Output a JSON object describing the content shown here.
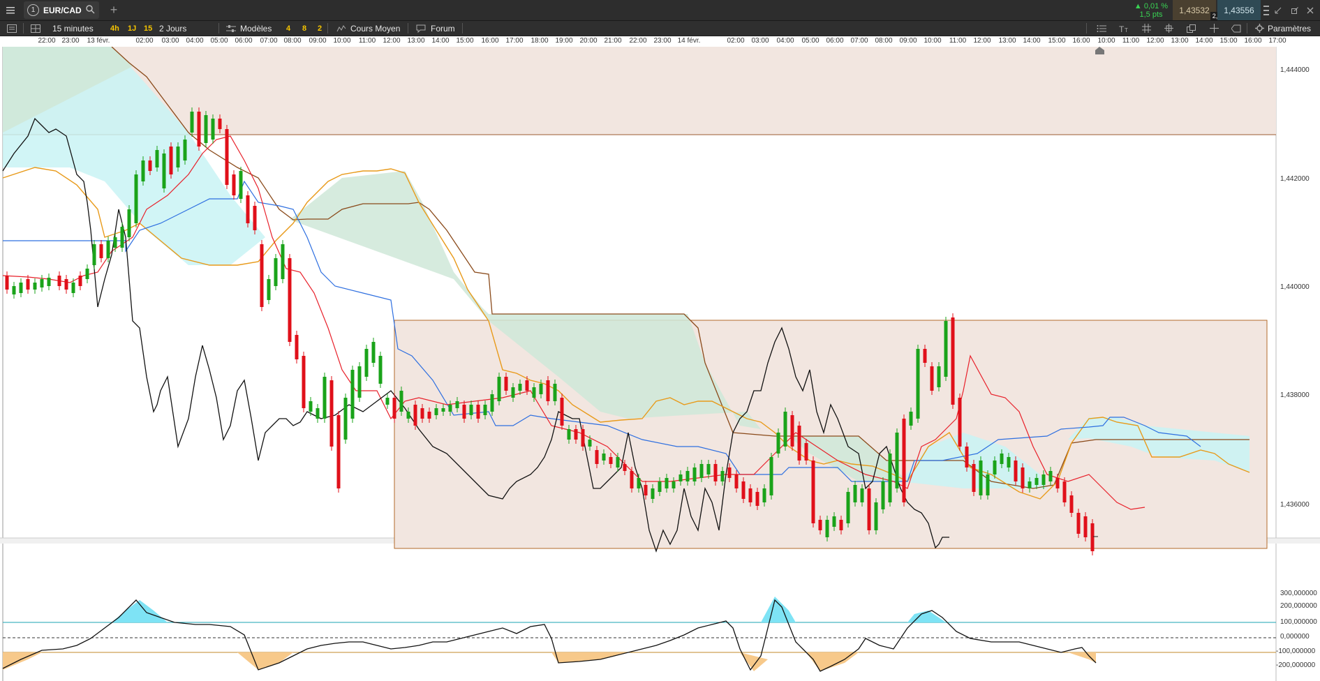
{
  "topbar": {
    "menu_icon": "hamburger-icon",
    "tab_number": "1",
    "symbol": "EUR/CAD",
    "add_tab": "+",
    "change_pct": "▲ 0,01 %",
    "change_pts": "1,5 pts",
    "bid": "1,43532",
    "spread": "2,4",
    "ask": "1,43556",
    "colors": {
      "up": "#39d353",
      "bid_bg": "#4a4030",
      "ask_bg": "#2f4a55"
    }
  },
  "toolbar": {
    "timeframe": "15 minutes",
    "quick_tf": [
      "4h",
      "1J",
      "15"
    ],
    "period": "2 Jours",
    "models": "Modèles",
    "counts": [
      "4",
      "8",
      "2"
    ],
    "avg_price": "Cours Moyen",
    "forum": "Forum",
    "settings": "Paramètres"
  },
  "time_axis": [
    "22:00",
    "23:00",
    "13 févr.",
    "02:00",
    "03:00",
    "04:00",
    "05:00",
    "06:00",
    "07:00",
    "08:00",
    "09:00",
    "10:00",
    "11:00",
    "12:00",
    "13:00",
    "14:00",
    "15:00",
    "16:00",
    "17:00",
    "18:00",
    "19:00",
    "20:00",
    "21:00",
    "22:00",
    "23:00",
    "14 févr.",
    "02:00",
    "03:00",
    "04:00",
    "05:00",
    "06:00",
    "07:00",
    "08:00",
    "09:00",
    "10:00",
    "11:00",
    "12:00",
    "13:00",
    "14:00",
    "15:00",
    "16:00",
    "10:00",
    "11:00",
    "12:00",
    "13:00",
    "14:00",
    "15:00",
    "16:00",
    "17:00"
  ],
  "price_axis": [
    "1,444000",
    "1,442000",
    "1,440000",
    "1,438000",
    "1,436000"
  ],
  "osc_axis": [
    "300,000000",
    "200,000000",
    "100,000000",
    "0,000000",
    "-100,000000",
    "-200,000000"
  ],
  "chart_data": {
    "type": "candlestick",
    "symbol": "EUR/CAD",
    "interval": "15 minutes",
    "ylim": [
      1.4351,
      1.4452
    ],
    "indicators": [
      "Ichimoku",
      "CCI"
    ],
    "osc_ylim": [
      -300,
      300
    ],
    "osc_levels": [
      100,
      0,
      -100
    ],
    "colors": {
      "up": "#1aa31a",
      "down": "#e0101a",
      "tenkan": "#e8202a",
      "kijun": "#2e6fe0",
      "chikou": "#111111",
      "span_a": "#e89a1a",
      "span_b": "#8a4a1a",
      "cloud_bull": "#c9f3f5",
      "cloud_bear": "#cfe8d8",
      "zone": "#f2e6e0"
    }
  }
}
